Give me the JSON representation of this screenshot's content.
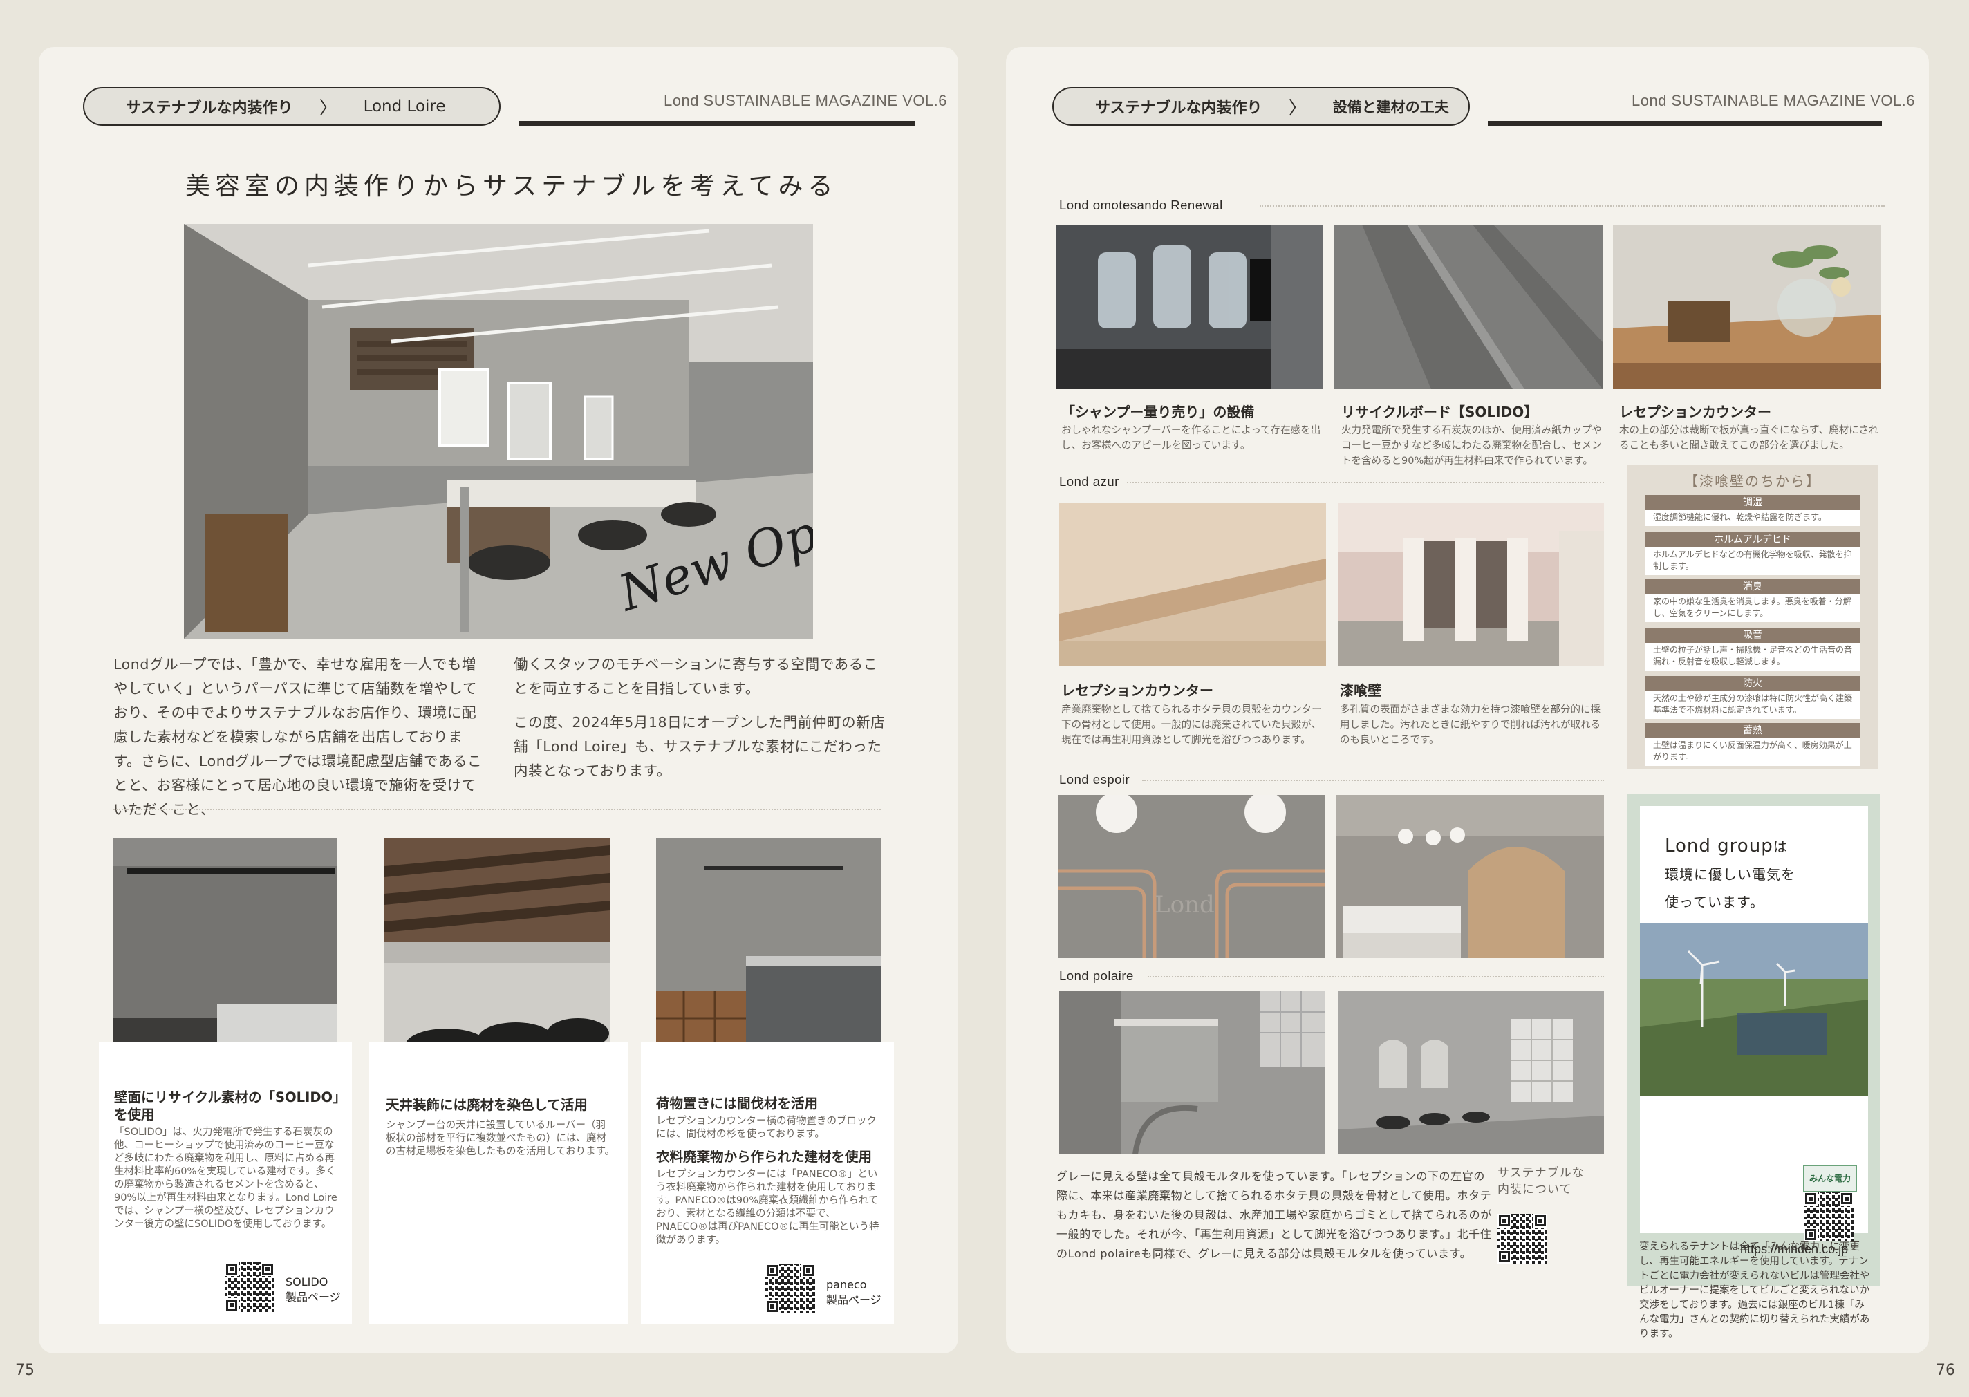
{
  "left": {
    "page_number": "75",
    "breadcrumb": {
      "section": "サステナブルな内装作り",
      "separator": "〉",
      "current": "Lond Loire"
    },
    "magazine": "Lond SUSTAINABLE MAGAZINE VOL.6",
    "title": "美容室の内装作りからサステナブルを考えてみる",
    "script_overlay": "New Open",
    "intro_col1": "Londグループでは、「豊かで、幸せな雇用を一人でも増やしていく」というパーパスに準じて店舗数を増やしており、その中でよりサステナブルなお店作り、環境に配慮した素材などを模索しながら店舗を出店しております。さらに、Londグループでは環境配慮型店舗であることと、お客様にとって居心地の良い環境で施術を受けていただくこと、",
    "intro_col2a": "働くスタッフのモチベーションに寄与する空間であることを両立することを目指しています。",
    "intro_col2b": "この度、2024年5月18日にオープンした門前仲町の新店舗「Lond Loire」も、サステナブルな素材にこだわった内装となっております。",
    "cards": [
      {
        "title": "壁面にリサイクル素材の「SOLIDO」を使用",
        "text": "「SOLIDO」は、火力発電所で発生する石炭灰の他、コーヒーショップで使用済みのコーヒー豆など多岐にわたる廃棄物を利用し、原料に占める再生材料比率約60%を実現している建材です。多くの廃棄物から製造されるセメントを含めると、90%以上が再生材料由来となります。Lond Loireでは、シャンプー横の壁及び、レセプションカウンター後方の壁にSOLIDOを使用しております。",
        "qr_label": "SOLIDO\n製品ページ"
      },
      {
        "title": "天井装飾には廃材を染色して活用",
        "text": "シャンプー台の天井に設置しているルーバー（羽板状の部材を平行に複数並べたもの）には、廃材の古材足場板を染色したものを活用しております。"
      },
      {
        "title": "荷物置きには間伐材を活用",
        "text": "レセプションカウンター横の荷物置きのブロックには、間伐材の杉を使っております。",
        "title2": "衣料廃棄物から作られた建材を使用",
        "text2": "レセプションカウンターには「PANECO®」という衣料廃棄物から作られた建材を使用しております。PANECO®は90%廃棄衣類繊維から作られており、素材となる繊維の分類は不要で、PNAECO®は再びPANECO®に再生可能という特徴があります。",
        "qr_label": "paneco\n製品ページ"
      }
    ]
  },
  "right": {
    "page_number": "76",
    "breadcrumb": {
      "section": "サステナブルな内装作り",
      "separator": "〉",
      "current": "設備と建材の工夫"
    },
    "magazine": "Lond SUSTAINABLE MAGAZINE VOL.6",
    "sections": {
      "omotesando": "Lond omotesando Renewal",
      "azur": "Lond azur",
      "espoir": "Lond espoir",
      "polaire": "Lond polaire"
    },
    "omote_caps": [
      {
        "title": "「シャンプー量り売り」の設備",
        "text": "おしゃれなシャンプーバーを作ることによって存在感を出し、お客様へのアピールを図っています。"
      },
      {
        "title": "リサイクルボード【SOLIDO】",
        "text": "火力発電所で発生する石炭灰のほか、使用済み紙カップやコーヒー豆かすなど多岐にわたる廃棄物を配合し、セメントを含めると90%超が再生材料由来で作られています。"
      },
      {
        "title": "レセプションカウンター",
        "text": "木の上の部分は裁断で板が真っ直ぐにならず、廃材にされることも多いと聞き敢えてこの部分を選びました。"
      }
    ],
    "azur_caps": [
      {
        "title": "レセプションカウンター",
        "text": "産業廃棄物として捨てられるホタテ貝の貝殻をカウンター下の骨材として使用。一般的には廃棄されていた貝殻が、現在では再生利用資源として脚光を浴びつつあります。"
      },
      {
        "title": "漆喰壁",
        "text": "多孔質の表面がさまざまな効力を持つ漆喰壁を部分的に採用しました。汚れたときに紙やすりで削れば汚れが取れるのも良いところです。"
      }
    ],
    "espoir_sign": "Lond",
    "shikkui": {
      "title": "【漆喰壁のちから】",
      "items": [
        {
          "head": "調湿",
          "body": "湿度調節機能に優れ、乾燥や結露を防ぎます。"
        },
        {
          "head": "ホルムアルデヒド",
          "body": "ホルムアルデヒドなどの有機化学物を吸収、発散を抑制します。"
        },
        {
          "head": "消臭",
          "body": "家の中の嫌な生活臭を消臭します。悪臭を吸着・分解し、空気をクリーンにします。"
        },
        {
          "head": "吸音",
          "body": "土壁の粒子が話し声・掃除機・足音などの生活音の音漏れ・反射音を吸収し軽減します。"
        },
        {
          "head": "防火",
          "body": "天然の土や砂が主成分の漆喰は特に防火性が高く建築基準法で不燃材料に認定されています。"
        },
        {
          "head": "蓄熱",
          "body": "土壁は温まりにくい反面保温力が高く、暖房効果が上がります。"
        }
      ]
    },
    "polaire_text": "グレーに見える壁は全て貝殻モルタルを使っています。「レセプションの下の左官の際に、本来は産業廃棄物として捨てられるホタテ貝の貝殻を骨材として使用。ホタテもカキも、身をむいた後の貝殻は、水産加工場や家庭からゴミとして捨てられるのが一般的でした。それが今、「再生利用資源」として脚光を浴びつつあります。」北千住のLond polaireも同様で、グレーに見える部分は貝殻モルタルを使っています。",
    "qr_note": "サステナブルな\n内装について",
    "green": {
      "title_l1": "Lond group",
      "title_l1b": "は",
      "title_l2": "環境に優しい電気を",
      "title_l3": "使っています。",
      "badge": "みんな電力",
      "text": "変えられるテナントは全て「みんな電力」に変更し、再生可能エネルギーを使用しています。テナントごとに電力会社が変えられないビルは管理会社やビルオーナーに提案をしてビルごと変えられないか交渉をしております。過去には銀座のビル1棟「みんな電力」さんとの契約に切り替えられた実績があります。",
      "url": "https://minden.co.jp"
    }
  }
}
